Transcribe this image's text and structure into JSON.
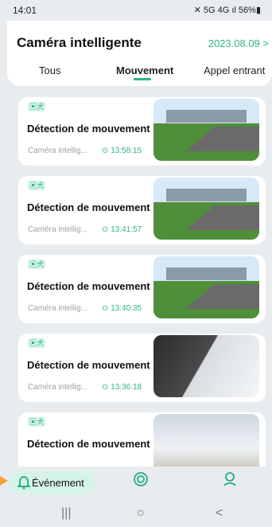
{
  "status": {
    "time": "14:01",
    "icons": "✕ 5G 4G ıl 56%▮"
  },
  "header": {
    "title": "Caméra intelligente",
    "date": "2023.08.09 >"
  },
  "tabs": [
    {
      "label": "Tous"
    },
    {
      "label": "Mouvement"
    },
    {
      "label": "Appel entrant"
    }
  ],
  "cards": [
    {
      "badge": "▣犬",
      "title": "Détection de mouvement",
      "camera": "Caméra intellig...",
      "time": "13:58:15"
    },
    {
      "badge": "▣犬",
      "title": "Détection de mouvement",
      "camera": "Caméra intellig...",
      "time": "13:41:57"
    },
    {
      "badge": "▣犬",
      "title": "Détection de mouvement",
      "camera": "Caméra intellig...",
      "time": "13:40:35"
    },
    {
      "badge": "▣犬",
      "title": "Détection de mouvement",
      "camera": "Caméra intellig...",
      "time": "13:36:18"
    },
    {
      "badge": "▣犬",
      "title": "Détection de mouvement",
      "camera": "",
      "time": ""
    }
  ],
  "bottom_nav": {
    "event_label": "Événement"
  },
  "system_nav": {
    "recent": "|||",
    "home": "○",
    "back": "<"
  }
}
